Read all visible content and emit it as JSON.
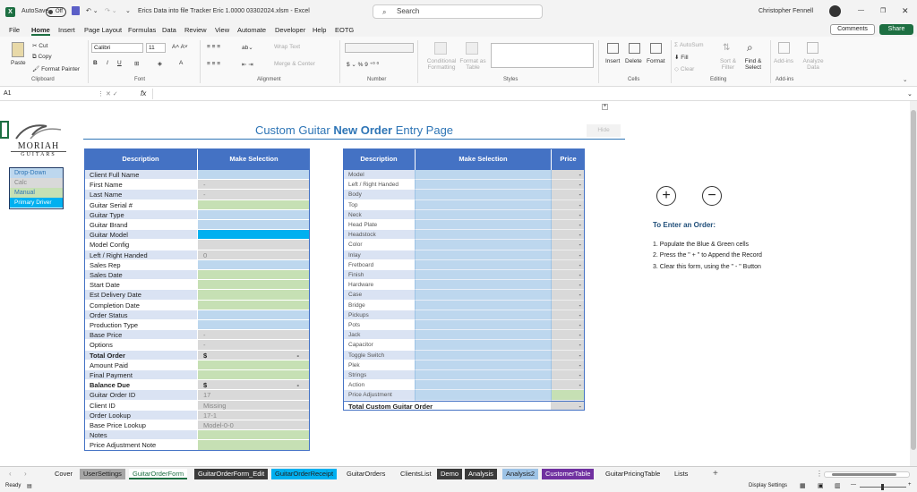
{
  "titlebar": {
    "autosave_label": "AutoSave",
    "autosave_state": "Off",
    "file_title": "Erics Data into file  Tracker Eric  1.0000  03302024.xlsm  -  Excel",
    "search_placeholder": "Search",
    "user_name": "Christopher Fennell"
  },
  "menu": [
    "File",
    "Home",
    "Insert",
    "Page Layout",
    "Formulas",
    "Data",
    "Review",
    "View",
    "Automate",
    "Developer",
    "Help",
    "EOTG"
  ],
  "menu_right": {
    "comments": "Comments",
    "share": "Share"
  },
  "ribbon": {
    "clipboard": {
      "paste": "Paste",
      "cut": "Cut",
      "copy": "Copy",
      "format_painter": "Format Painter",
      "group": "Clipboard"
    },
    "font": {
      "name": "Calibri",
      "size": "11",
      "group": "Font"
    },
    "alignment": {
      "wrap": "Wrap Text",
      "merge": "Merge & Center",
      "group": "Alignment"
    },
    "number": {
      "group": "Number"
    },
    "styles": {
      "conditional": "Conditional Formatting",
      "format_table": "Format as Table",
      "group": "Styles"
    },
    "cells": {
      "insert": "Insert",
      "delete": "Delete",
      "format": "Format",
      "group": "Cells"
    },
    "editing": {
      "autosum": "AutoSum",
      "fill": "Fill",
      "clear": "Clear",
      "sort": "Sort & Filter",
      "find": "Find & Select",
      "group": "Editing"
    },
    "addins": {
      "addins": "Add-ins",
      "analyze": "Analyze Data",
      "group": "Add-ins"
    }
  },
  "formula_bar": {
    "name_box": "A1",
    "fx": "fx"
  },
  "sheet": {
    "title_part1": "Custom Guitar ",
    "title_bold": "New Order",
    "title_part2": " Entry Page",
    "hide_button": "Hide",
    "logo_line1": "MORIAH",
    "logo_line2": "GUITARS",
    "legend": [
      {
        "label": "Drop-Down",
        "color": "#bdd7ee"
      },
      {
        "label": "Calc",
        "color": "#d9d9d9"
      },
      {
        "label": "Manual",
        "color": "#c6e0b4"
      },
      {
        "label": "Primary Driver",
        "color": "#00b0f0"
      }
    ],
    "left_table": {
      "headers": [
        "Description",
        "Make Selection"
      ],
      "rows": [
        {
          "label": "Client Full Name",
          "value": "",
          "color": "#bdd7ee"
        },
        {
          "label": "First Name",
          "value": "-",
          "color": "#d9d9d9"
        },
        {
          "label": "Last Name",
          "value": "-",
          "color": "#d9d9d9"
        },
        {
          "label": "Guitar Serial #",
          "value": "",
          "color": "#c6e0b4"
        },
        {
          "label": "Guitar Type",
          "value": "",
          "color": "#bdd7ee"
        },
        {
          "label": "Guitar Brand",
          "value": "",
          "color": "#bdd7ee"
        },
        {
          "label": "Guitar Model",
          "value": "",
          "color": "#00b0f0"
        },
        {
          "label": "Model Config",
          "value": "",
          "color": "#d9d9d9"
        },
        {
          "label": "Left / Right Handed",
          "value": "0",
          "color": "#d9d9d9"
        },
        {
          "label": "Sales Rep",
          "value": "",
          "color": "#bdd7ee"
        },
        {
          "label": "Sales Date",
          "value": "",
          "color": "#c6e0b4"
        },
        {
          "label": "Start Date",
          "value": "",
          "color": "#c6e0b4"
        },
        {
          "label": "Est Delivery Date",
          "value": "",
          "color": "#c6e0b4"
        },
        {
          "label": "Completion Date",
          "value": "",
          "color": "#c6e0b4"
        },
        {
          "label": "Order Status",
          "value": "",
          "color": "#bdd7ee"
        },
        {
          "label": "Production Type",
          "value": "",
          "color": "#bdd7ee"
        },
        {
          "label": "Base Price",
          "value": "-",
          "color": "#d9d9d9"
        },
        {
          "label": "Options",
          "value": "-",
          "color": "#d9d9d9"
        },
        {
          "label": "Total Order",
          "value": "$",
          "value2": "-",
          "color": "#d9d9d9",
          "bold": true
        },
        {
          "label": "Amount Paid",
          "value": "",
          "color": "#c6e0b4"
        },
        {
          "label": "Final Payment",
          "value": "",
          "color": "#c6e0b4"
        },
        {
          "label": "Balance Due",
          "value": "$",
          "value2": "-",
          "color": "#d9d9d9",
          "bold": true
        },
        {
          "label": "Guitar Order ID",
          "value": "17",
          "color": "#d9d9d9"
        },
        {
          "label": "Client ID",
          "value": "Missing",
          "color": "#d9d9d9"
        },
        {
          "label": "Order Lookup",
          "value": "17-1",
          "color": "#d9d9d9"
        },
        {
          "label": "Base Price Lookup",
          "value": "Model-0-0",
          "color": "#d9d9d9"
        },
        {
          "label": "Notes",
          "value": "",
          "color": "#c6e0b4"
        },
        {
          "label": "Price Adjustment Note",
          "value": "",
          "color": "#c6e0b4"
        }
      ]
    },
    "right_table": {
      "headers": [
        "Description",
        "Make Selection",
        "Price"
      ],
      "rows": [
        "Model",
        "Left / Right Handed",
        "Body",
        "Top",
        "Neck",
        "Head Plate",
        "Headstock",
        "Color",
        "Inlay",
        "Fretboard",
        "Finish",
        "Hardware",
        "Case",
        "Bridge",
        "Pickups",
        "Pots",
        "Jack",
        "Capacitor",
        "Toggle Switch",
        "Plek",
        "Strings",
        "Action",
        "Price Adjustment"
      ],
      "price_value": "-",
      "total_label": "Total Custom Guitar Order",
      "total_value": "-"
    },
    "instructions": {
      "plus": "+",
      "minus": "−",
      "heading": "To Enter an Order:",
      "steps": [
        "1. Populate the Blue & Green cells",
        "2. Press the \" + \" to Append the Record",
        "3.  Clear this form, using the \" - \" Button"
      ]
    }
  },
  "tabs": [
    {
      "label": "Cover",
      "bg": "#f3f3f3",
      "fg": "#222"
    },
    {
      "label": "UserSettings",
      "bg": "#a6a6a6",
      "fg": "#222"
    },
    {
      "label": "GuitarOrderForm",
      "bg": "#ffffff",
      "fg": "#1d6f42",
      "active": true
    },
    {
      "label": "GuitarOrderForm_Edit",
      "bg": "#3a3a3a",
      "fg": "#fff"
    },
    {
      "label": "GuitarOrderReceipt",
      "bg": "#00b0f0",
      "fg": "#222"
    },
    {
      "label": "GuitarOrders",
      "bg": "#f3f3f3",
      "fg": "#222"
    },
    {
      "label": "ClientsList",
      "bg": "#f3f3f3",
      "fg": "#222"
    },
    {
      "label": "Demo",
      "bg": "#3a3a3a",
      "fg": "#fff"
    },
    {
      "label": "Analysis",
      "bg": "#3a3a3a",
      "fg": "#fff"
    },
    {
      "label": "Analysis2",
      "bg": "#9dc3e6",
      "fg": "#222"
    },
    {
      "label": "CustomerTable",
      "bg": "#7030a0",
      "fg": "#fff"
    },
    {
      "label": "GuitarPricingTable",
      "bg": "#f3f3f3",
      "fg": "#222"
    },
    {
      "label": "Lists",
      "bg": "#f3f3f3",
      "fg": "#222"
    }
  ],
  "status": {
    "ready": "Ready",
    "display": "Display Settings"
  }
}
